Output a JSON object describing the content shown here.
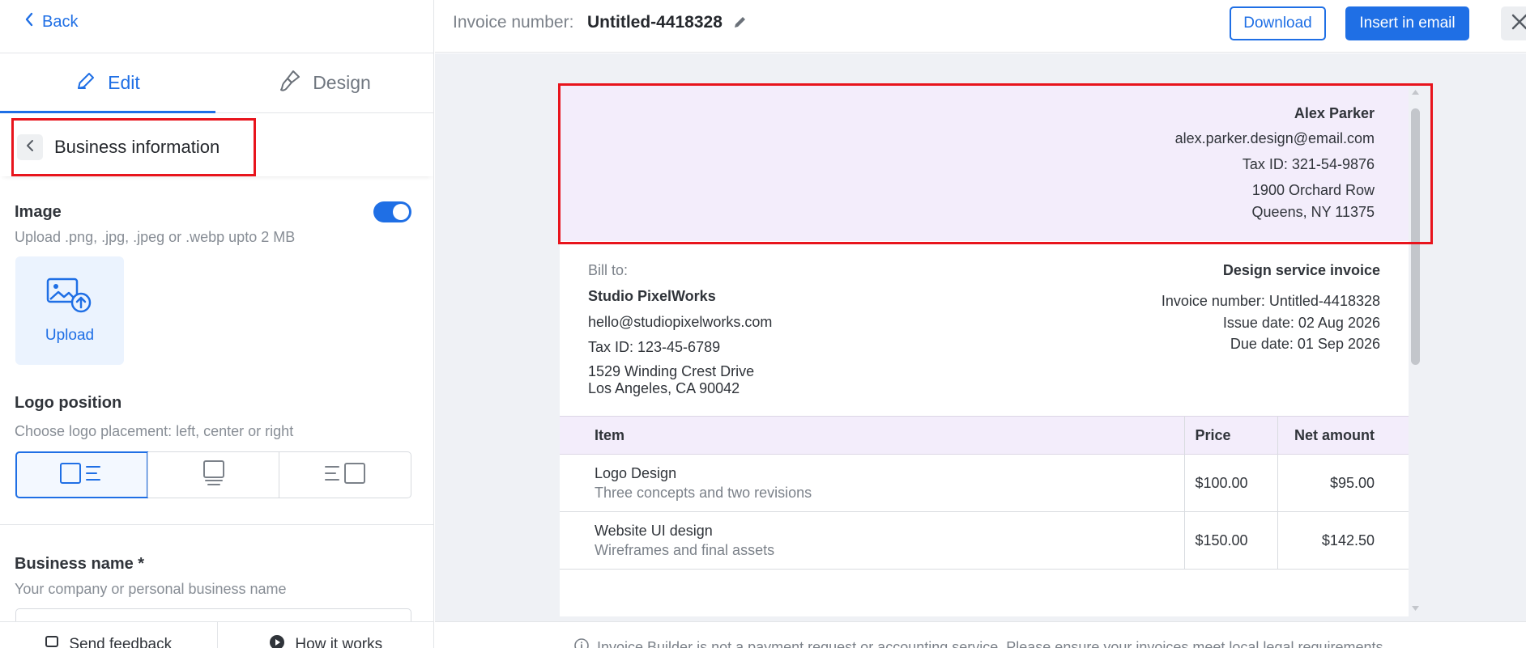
{
  "sidebar": {
    "back_label": "Back",
    "tabs": [
      {
        "label": "Edit",
        "icon": "pencil-icon",
        "active": true
      },
      {
        "label": "Design",
        "icon": "paintbrush-icon",
        "active": false
      }
    ],
    "section_title": "Business information",
    "image": {
      "label": "Image",
      "enabled": true,
      "hint": "Upload .png, .jpg, .jpeg or .webp upto 2 MB",
      "upload_label": "Upload"
    },
    "logo_position": {
      "label": "Logo position",
      "hint": "Choose logo placement: left, center or right",
      "options": [
        "left",
        "center",
        "right"
      ],
      "selected": "left"
    },
    "business_name": {
      "label": "Business name *",
      "hint": "Your company or personal business name",
      "value": ""
    },
    "footer": {
      "feedback_label": "Send feedback",
      "how_label": "How it works"
    }
  },
  "topbar": {
    "invoice_label": "Invoice number:",
    "invoice_value": "Untitled-4418328",
    "download_label": "Download",
    "insert_label": "Insert in email"
  },
  "invoice": {
    "business": {
      "name": "Alex Parker",
      "email": "alex.parker.design@email.com",
      "tax": "Tax ID: 321-54-9876",
      "address1": "1900 Orchard Row",
      "address2": "Queens, NY 11375"
    },
    "bill_to": {
      "label": "Bill to:",
      "name": "Studio PixelWorks",
      "email": "hello@studiopixelworks.com",
      "tax": "Tax ID: 123-45-6789",
      "address1": "1529 Winding Crest Drive",
      "address2": "Los Angeles, CA 90042"
    },
    "meta": {
      "title": "Design service invoice",
      "number": "Invoice number: Untitled-4418328",
      "issue": "Issue date: 02 Aug 2026",
      "due": "Due date: 01 Sep 2026"
    },
    "table": {
      "headers": {
        "item": "Item",
        "price": "Price",
        "net": "Net amount"
      },
      "rows": [
        {
          "item": "Logo Design",
          "desc": "Three concepts and two revisions",
          "price": "$100.00",
          "net": "$95.00"
        },
        {
          "item": "Website UI design",
          "desc": "Wireframes and final assets",
          "price": "$150.00",
          "net": "$142.50"
        }
      ]
    }
  },
  "disclaimer": "Invoice Builder is not a payment request or accounting service. Please ensure your invoices meet local legal requirements.",
  "colors": {
    "accent": "#1f6fe5",
    "highlight": "#e8141c",
    "band": "#f3edfb"
  }
}
